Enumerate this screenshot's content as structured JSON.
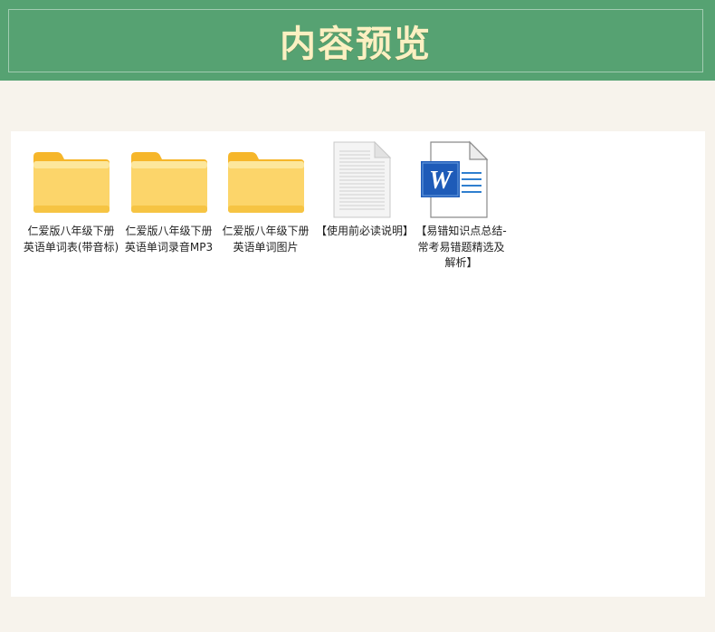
{
  "header": {
    "title": "内容预览"
  },
  "files": [
    {
      "type": "folder",
      "icon": "folder-icon",
      "label": "仁爱版八年级下册英语单词表(带音标)"
    },
    {
      "type": "folder",
      "icon": "folder-icon",
      "label": "仁爱版八年级下册英语单词录音MP3"
    },
    {
      "type": "folder",
      "icon": "folder-icon",
      "label": "仁爱版八年级下册英语单词图片"
    },
    {
      "type": "text-document",
      "icon": "text-document-icon",
      "label": "【使用前必读说明】"
    },
    {
      "type": "word-document",
      "icon": "word-document-icon",
      "label": "【易错知识点总结-常考易错题精选及解析】"
    }
  ],
  "colors": {
    "header_bg": "#56a272",
    "title_text": "#fbf0c2",
    "page_bg": "#f7f3ec",
    "folder": "#fcd56a",
    "word_blue": "#1e5bb8"
  }
}
